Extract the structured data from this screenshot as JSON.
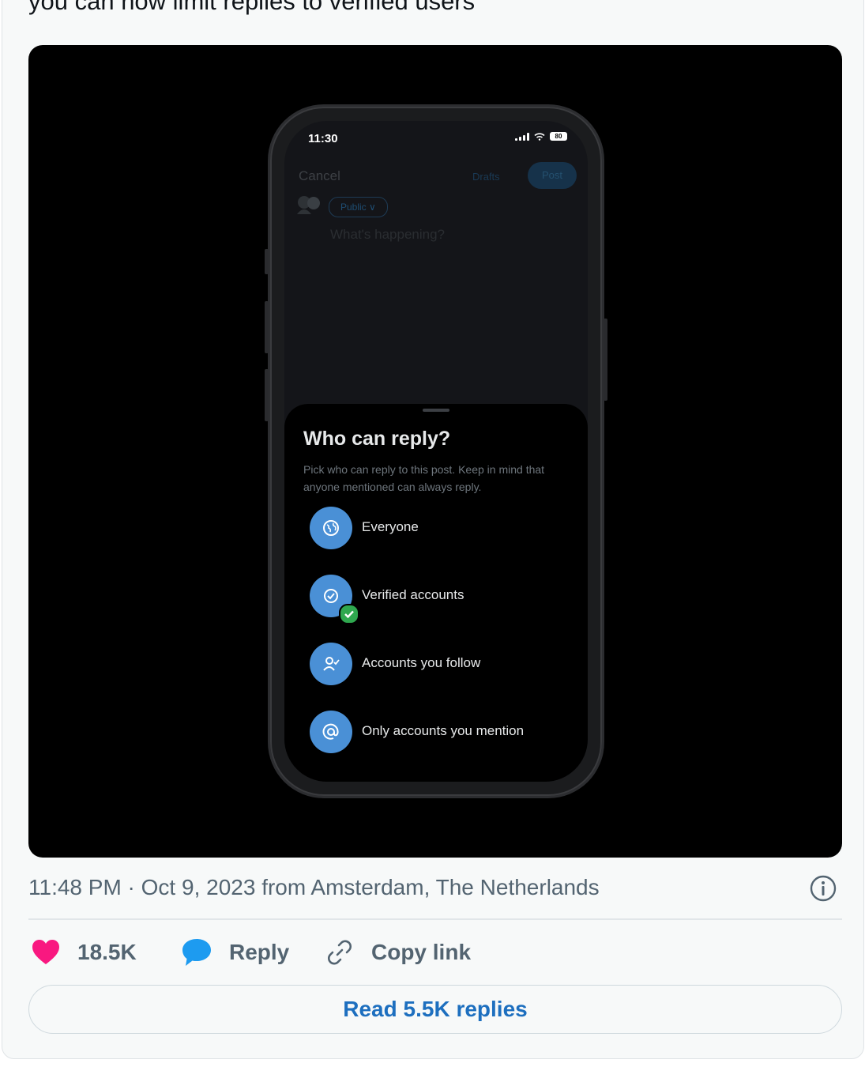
{
  "tweet": {
    "text": "you can now limit replies to verified users"
  },
  "phone": {
    "status_time": "11:30",
    "battery": "80",
    "compose": {
      "cancel": "Cancel",
      "drafts": "Drafts",
      "post": "Post",
      "audience": "Public ∨",
      "placeholder": "What's happening?"
    },
    "sheet": {
      "title": "Who can reply?",
      "subtitle": "Pick who can reply to this post. Keep in mind that anyone mentioned can always reply.",
      "options": [
        {
          "label": "Everyone",
          "icon": "globe-icon",
          "selected": false
        },
        {
          "label": "Verified accounts",
          "icon": "verified-icon",
          "selected": true
        },
        {
          "label": "Accounts you follow",
          "icon": "person-check-icon",
          "selected": false
        },
        {
          "label": "Only accounts you mention",
          "icon": "at-icon",
          "selected": false
        }
      ]
    }
  },
  "meta": {
    "timestamp": "11:48 PM · Oct 9, 2023 from Amsterdam, The Netherlands"
  },
  "actions": {
    "likes": "18.5K",
    "reply": "Reply",
    "copy_link": "Copy link"
  },
  "read_replies": "Read 5.5K replies",
  "colors": {
    "like": "#f91880",
    "reply": "#1d9bf0",
    "link_text": "#1d6fbf",
    "option_circle": "#4a90d6",
    "verified_check": "#2fa84f"
  }
}
